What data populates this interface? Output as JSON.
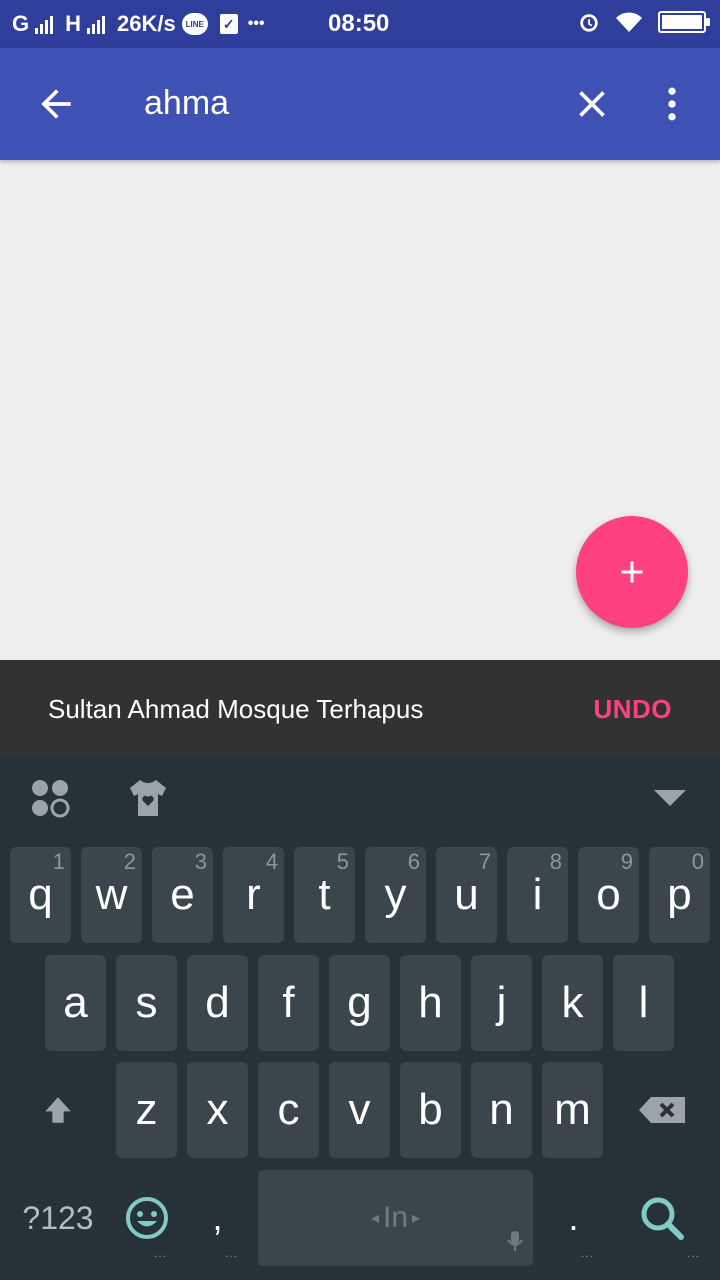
{
  "status_bar": {
    "carrier1": "G",
    "carrier2": "H",
    "speed": "26K/s",
    "line_badge": "LINE",
    "dots": "•••",
    "time": "08:50",
    "battery_level": 1.0,
    "icons": [
      "signal-icon",
      "line-app-icon",
      "checkbox-icon",
      "alarm-icon",
      "wifi-icon",
      "battery-icon"
    ]
  },
  "app_bar": {
    "search_query": "ahma",
    "background": "#3f51b5"
  },
  "snackbar": {
    "message": "Sultan Ahmad Mosque Terhapus",
    "action": "UNDO",
    "action_color": "#ff4081"
  },
  "fab": {
    "color": "#ff4081",
    "icon": "plus-icon"
  },
  "keyboard": {
    "row1": [
      {
        "k": "q",
        "h": "1"
      },
      {
        "k": "w",
        "h": "2"
      },
      {
        "k": "e",
        "h": "3"
      },
      {
        "k": "r",
        "h": "4"
      },
      {
        "k": "t",
        "h": "5"
      },
      {
        "k": "y",
        "h": "6"
      },
      {
        "k": "u",
        "h": "7"
      },
      {
        "k": "i",
        "h": "8"
      },
      {
        "k": "o",
        "h": "9"
      },
      {
        "k": "p",
        "h": "0"
      }
    ],
    "row2": [
      "a",
      "s",
      "d",
      "f",
      "g",
      "h",
      "j",
      "k",
      "l"
    ],
    "row3": [
      "z",
      "x",
      "c",
      "v",
      "b",
      "n",
      "m"
    ],
    "symbols_label": "?123",
    "comma_label": ",",
    "period_label": ".",
    "space_label": "In",
    "icons": [
      "apps-icon",
      "theme-shirt-icon",
      "hide-keyboard-icon",
      "shift-icon",
      "backspace-icon",
      "emoji-icon",
      "mic-icon",
      "search-icon"
    ]
  }
}
